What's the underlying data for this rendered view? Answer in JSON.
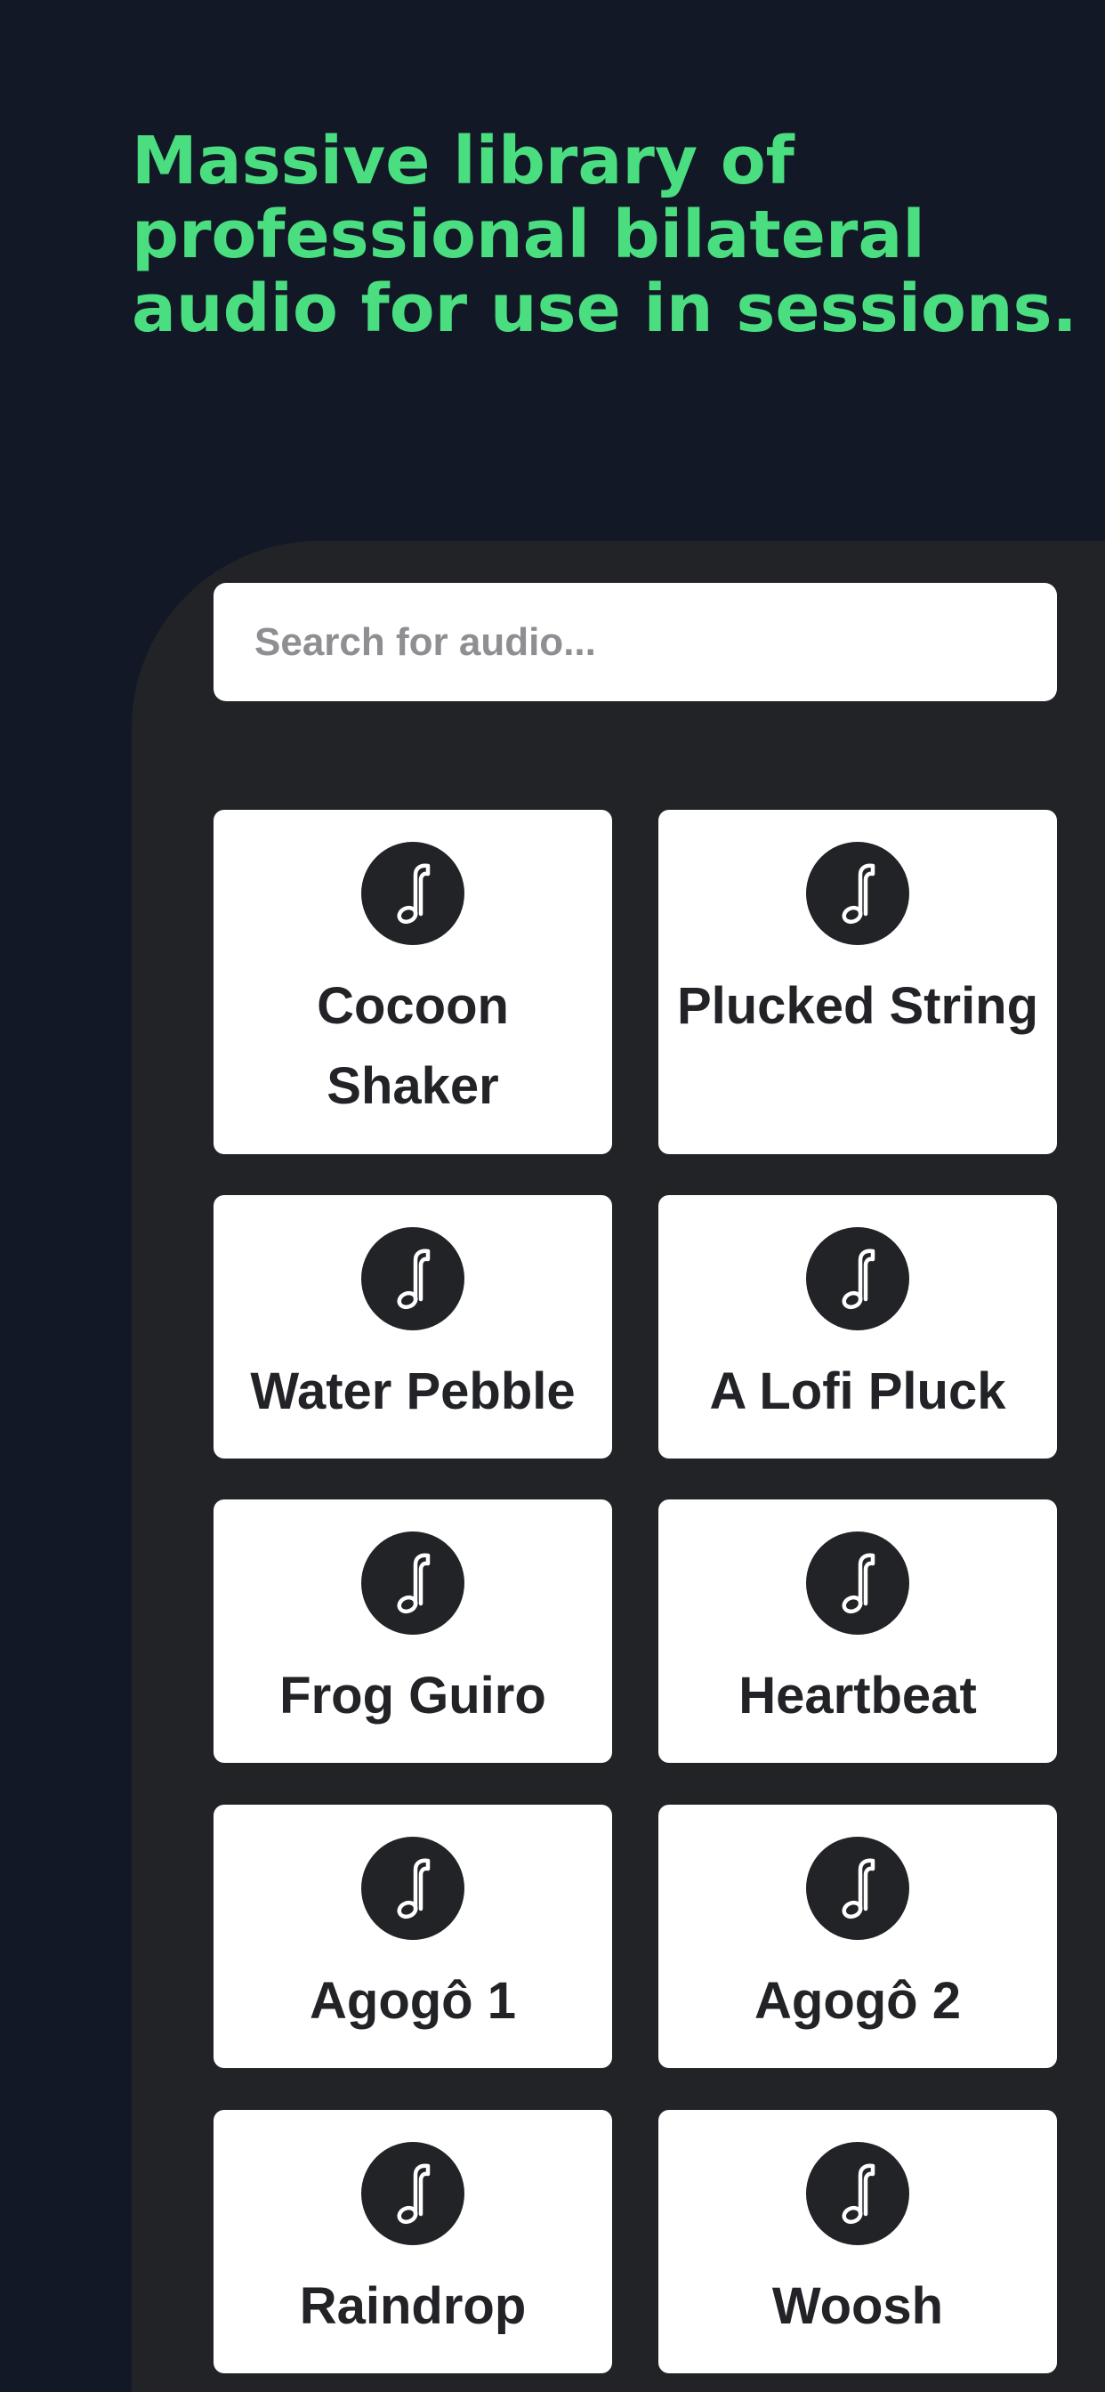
{
  "headline": "Massive library of professional bilateral audio for use in sessions.",
  "search": {
    "placeholder": "Search for audio..."
  },
  "colors": {
    "background": "#121826",
    "accent": "#4ade80",
    "panel": "#222327",
    "card": "#ffffff",
    "placeholder": "#8e8e93"
  },
  "audio_items": [
    {
      "label": "Cocoon Shaker",
      "icon": "music-note-icon"
    },
    {
      "label": "Plucked String",
      "icon": "music-note-icon"
    },
    {
      "label": "Water Pebble",
      "icon": "music-note-icon"
    },
    {
      "label": "A Lofi Pluck",
      "icon": "music-note-icon"
    },
    {
      "label": "Frog Guiro",
      "icon": "music-note-icon"
    },
    {
      "label": "Heartbeat",
      "icon": "music-note-icon"
    },
    {
      "label": "Agogô 1",
      "icon": "music-note-icon"
    },
    {
      "label": "Agogô 2",
      "icon": "music-note-icon"
    },
    {
      "label": "Raindrop",
      "icon": "music-note-icon"
    },
    {
      "label": "Woosh",
      "icon": "music-note-icon"
    }
  ]
}
